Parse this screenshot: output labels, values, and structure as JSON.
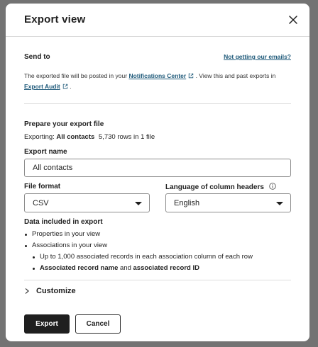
{
  "modal": {
    "title": "Export view",
    "close_icon": "close-icon"
  },
  "send_to": {
    "label": "Send to",
    "help_link": "Not getting our emails?",
    "desc_prefix": "The exported file will be posted in your",
    "notifications_link": "Notifications Center",
    "desc_middle": ". View this and past exports in",
    "audit_link": "Export Audit",
    "desc_suffix": "."
  },
  "prepare": {
    "heading": "Prepare your export file",
    "exporting_label": "Exporting:",
    "exporting_value": "All contacts",
    "rows_info": "5,730 rows in 1 file"
  },
  "export_name": {
    "label": "Export name",
    "value": "All contacts"
  },
  "file_format": {
    "label": "File format",
    "value": "CSV"
  },
  "language": {
    "label": "Language of column headers",
    "info_icon": "info-icon",
    "value": "English"
  },
  "data_included": {
    "heading": "Data included in export",
    "item1": "Properties in your view",
    "item2": "Associations in your view",
    "sub1": "Up to 1,000 associated records in each association column of each row",
    "sub2_a": "Associated record name",
    "sub2_and": "and",
    "sub2_b": "associated record ID"
  },
  "customize": {
    "label": "Customize"
  },
  "footer": {
    "export_button": "Export",
    "cancel_button": "Cancel"
  },
  "colors": {
    "link": "#1f5a7a",
    "primary": "#1f1f1f"
  }
}
